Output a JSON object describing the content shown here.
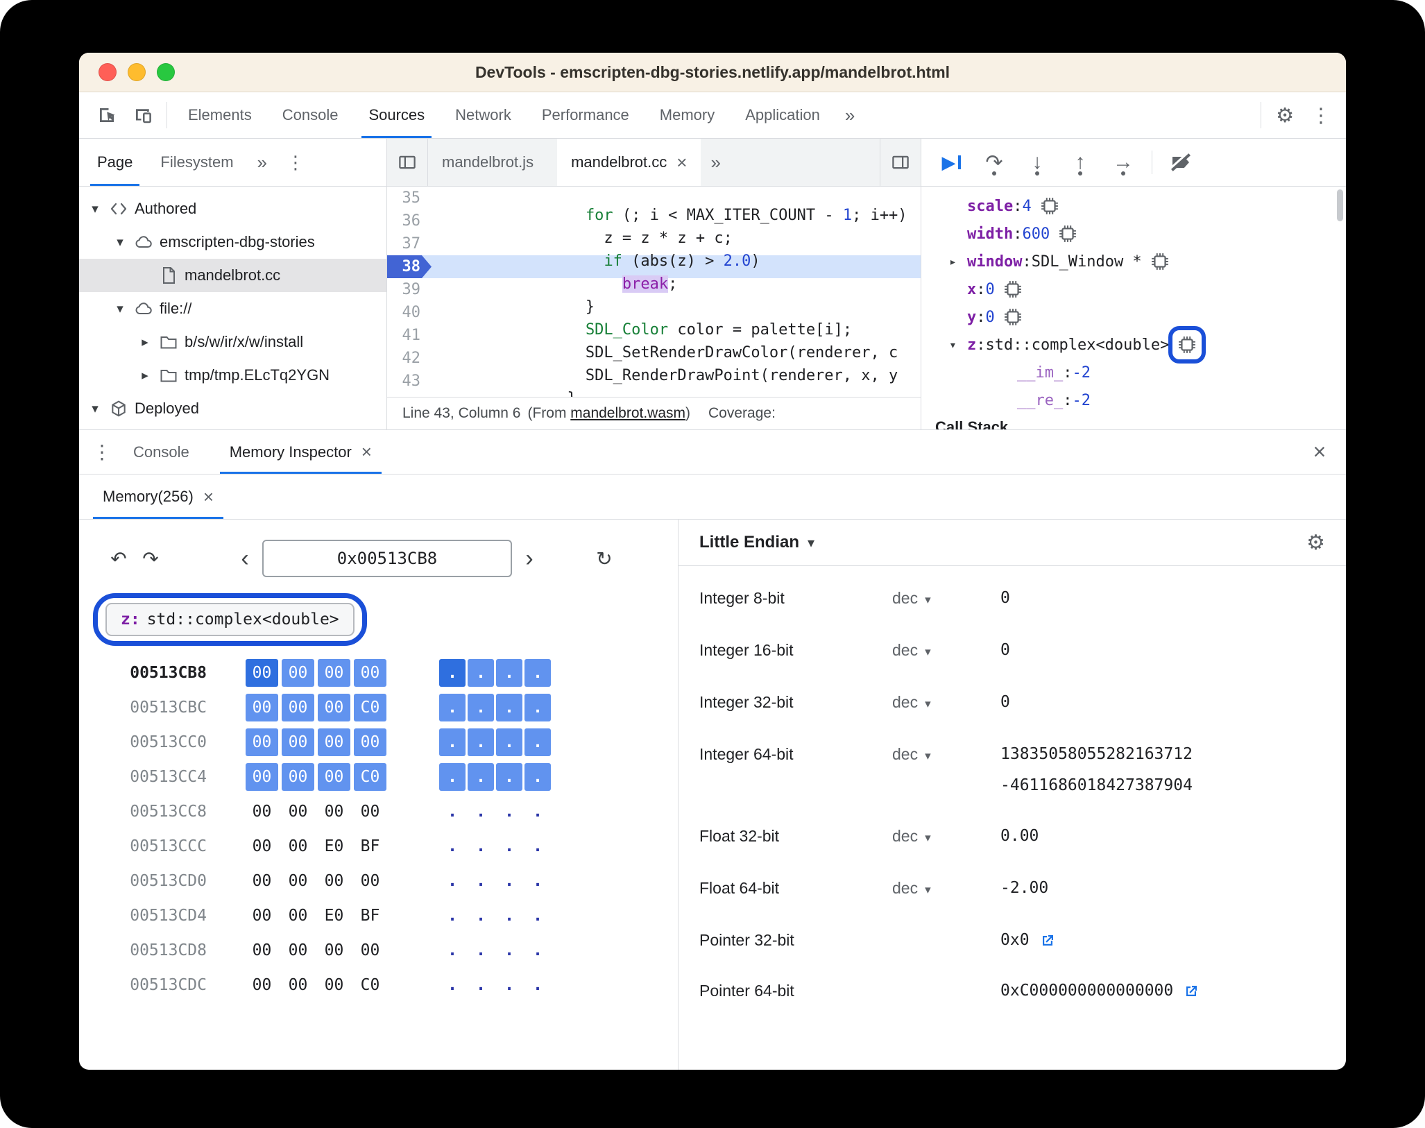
{
  "colors": {
    "accent_blue": "#1a73e8",
    "annotation_blue": "#1a4fd8",
    "memory_highlight": "#6193ef",
    "memory_focus": "#2f6fdf",
    "paused_line_bg": "#d3e3fc",
    "keyword_green": "#188038",
    "number_blue": "#2244d0",
    "variable_purple": "#7d1fa5"
  },
  "icons": {
    "gear": "⚙",
    "menu": "⋮",
    "more": "»",
    "close": "×",
    "undo": "↶",
    "redo": "↷",
    "refresh": "↻",
    "chev_left": "‹",
    "chev_right": "›",
    "dropdown": "▾",
    "resume": "▶"
  },
  "window_title": "DevTools - emscripten-dbg-stories.netlify.app/mandelbrot.html",
  "main_toolbar": {
    "tabs": [
      {
        "label": "Elements",
        "cls": ""
      },
      {
        "label": "Console",
        "cls": ""
      },
      {
        "label": "Sources",
        "cls": "active"
      },
      {
        "label": "Network",
        "cls": ""
      },
      {
        "label": "Performance",
        "cls": ""
      },
      {
        "label": "Memory",
        "cls": ""
      },
      {
        "label": "Application",
        "cls": ""
      }
    ]
  },
  "sidebar": {
    "tabs": [
      {
        "label": "Page",
        "cls": "active"
      },
      {
        "label": "Filesystem",
        "cls": ""
      }
    ],
    "tree": [
      {
        "label": "Authored",
        "icon": "ic-code",
        "chev": "▾",
        "ind": "ind-0",
        "cls": ""
      },
      {
        "label": "emscripten-dbg-stories",
        "icon": "ic-cloud",
        "chev": "▾",
        "ind": "ind-1",
        "cls": ""
      },
      {
        "label": "mandelbrot.cc",
        "icon": "ic-file",
        "chev": "",
        "ind": "ind-2",
        "cls": "selected"
      },
      {
        "label": "file://",
        "icon": "ic-cloud",
        "chev": "▾",
        "ind": "ind-1",
        "cls": ""
      },
      {
        "label": "b/s/w/ir/x/w/install",
        "icon": "ic-folder",
        "chev": "▸",
        "ind": "ind-2",
        "cls": ""
      },
      {
        "label": "tmp/tmp.ELcTq2YGN",
        "icon": "ic-folder",
        "chev": "▸",
        "ind": "ind-2",
        "cls": ""
      },
      {
        "label": "Deployed",
        "icon": "ic-cube",
        "chev": "▾",
        "ind": "ind-0",
        "cls": ""
      }
    ]
  },
  "editor": {
    "tabs": [
      {
        "label": "mandelbrot.js",
        "cls": "",
        "close": ""
      },
      {
        "label": "mandelbrot.cc",
        "cls": "active",
        "close": "×"
      }
    ],
    "lines": [
      {
        "num": "35",
        "cls": "",
        "tokens": [
          {
            "t": "    ",
            "c": ""
          },
          {
            "t": "for",
            "c": "tk-kw"
          },
          {
            "t": " (; i < MAX_ITER_COUNT - ",
            "c": ""
          },
          {
            "t": "1",
            "c": "tk-num"
          },
          {
            "t": "; i++)",
            "c": ""
          }
        ]
      },
      {
        "num": "36",
        "cls": "",
        "tokens": [
          {
            "t": "      z = z * z + c;",
            "c": ""
          }
        ]
      },
      {
        "num": "37",
        "cls": "",
        "tokens": [
          {
            "t": "      ",
            "c": ""
          },
          {
            "t": "if",
            "c": "tk-kw"
          },
          {
            "t": " (abs(z) > ",
            "c": ""
          },
          {
            "t": "2.0",
            "c": "tk-num"
          },
          {
            "t": ")",
            "c": ""
          }
        ]
      },
      {
        "num": "38",
        "cls": "paused",
        "tokens": [
          {
            "t": "        ",
            "c": ""
          },
          {
            "t": "break",
            "c": "tk-paused"
          },
          {
            "t": ";",
            "c": ""
          }
        ]
      },
      {
        "num": "39",
        "cls": "",
        "tokens": [
          {
            "t": "    }",
            "c": ""
          }
        ]
      },
      {
        "num": "40",
        "cls": "",
        "tokens": [
          {
            "t": "    ",
            "c": ""
          },
          {
            "t": "SDL_Color",
            "c": "tk-type"
          },
          {
            "t": " color = palette[i];",
            "c": ""
          }
        ]
      },
      {
        "num": "41",
        "cls": "",
        "tokens": [
          {
            "t": "    SDL_SetRenderDrawColor(renderer, c",
            "c": ""
          }
        ]
      },
      {
        "num": "42",
        "cls": "",
        "tokens": [
          {
            "t": "    SDL_RenderDrawPoint(renderer, x, y",
            "c": ""
          }
        ]
      },
      {
        "num": "43",
        "cls": "",
        "tokens": [
          {
            "t": "  }",
            "c": ""
          }
        ]
      }
    ],
    "status": {
      "position": "Line 43, Column 6",
      "from_open": "(From ",
      "link": "mandelbrot.wasm",
      "from_close": ")",
      "coverage": "Coverage:"
    }
  },
  "debugger": {
    "toolbar_icons": [
      {
        "name": "step-over-icon",
        "glyph": "↷",
        "cls": "dot-under"
      },
      {
        "name": "step-into-icon",
        "glyph": "↓",
        "cls": "dot-under"
      },
      {
        "name": "step-out-icon",
        "glyph": "↑",
        "cls": "dot-under"
      },
      {
        "name": "step-icon",
        "glyph": "→",
        "cls": "dot-under"
      }
    ],
    "scope": [
      {
        "name": "scale",
        "value": "4",
        "vcls": "v-num",
        "chev": "",
        "chip": "show",
        "rcls": ""
      },
      {
        "name": "width",
        "value": "600",
        "vcls": "v-num",
        "chev": "",
        "chip": "show",
        "rcls": ""
      },
      {
        "name": "window",
        "value": "SDL_Window *",
        "vcls": "v-obj",
        "chev": "▸",
        "chip": "show",
        "rcls": ""
      },
      {
        "name": "x",
        "value": "0",
        "vcls": "v-num",
        "chev": "",
        "chip": "show",
        "rcls": ""
      },
      {
        "name": "y",
        "value": "0",
        "vcls": "v-num",
        "chev": "",
        "chip": "show",
        "rcls": ""
      },
      {
        "name": "z",
        "value": "std::complex<double>",
        "vcls": "v-obj",
        "chev": "▾",
        "chip": "show",
        "rcls": "annotated"
      },
      {
        "name": "__im_",
        "value": "-2",
        "vcls": "v-num",
        "chev": "",
        "chip": "",
        "rcls": "child"
      },
      {
        "name": "__re_",
        "value": "-2",
        "vcls": "v-num",
        "chev": "",
        "chip": "",
        "rcls": "child"
      }
    ],
    "section_below": "Call Stack"
  },
  "drawer": {
    "tabs": [
      {
        "label": "Console",
        "cls": "",
        "close": ""
      },
      {
        "label": "Memory Inspector",
        "cls": "active",
        "close": "×"
      }
    ],
    "memory_tab": {
      "label": "Memory(256)",
      "close": "×"
    }
  },
  "memory": {
    "address_field": "0x00513CB8",
    "tag_name": "z:",
    "tag_type": "std::complex<double>",
    "rows": [
      {
        "addr": "00513CB8",
        "acls": "sel",
        "bytes": [
          {
            "v": "00",
            "c": "focus"
          },
          {
            "v": "00",
            "c": "hl"
          },
          {
            "v": "00",
            "c": "hl"
          },
          {
            "v": "00",
            "c": "hl"
          }
        ],
        "ascii": [
          {
            "v": ".",
            "c": "focus"
          },
          {
            "v": ".",
            "c": "hl"
          },
          {
            "v": ".",
            "c": "hl"
          },
          {
            "v": ".",
            "c": "hl"
          }
        ]
      },
      {
        "addr": "00513CBC",
        "acls": "",
        "bytes": [
          {
            "v": "00",
            "c": "hl"
          },
          {
            "v": "00",
            "c": "hl"
          },
          {
            "v": "00",
            "c": "hl"
          },
          {
            "v": "C0",
            "c": "hl"
          }
        ],
        "ascii": [
          {
            "v": ".",
            "c": "hl"
          },
          {
            "v": ".",
            "c": "hl"
          },
          {
            "v": ".",
            "c": "hl"
          },
          {
            "v": ".",
            "c": "hl"
          }
        ]
      },
      {
        "addr": "00513CC0",
        "acls": "",
        "bytes": [
          {
            "v": "00",
            "c": "hl"
          },
          {
            "v": "00",
            "c": "hl"
          },
          {
            "v": "00",
            "c": "hl"
          },
          {
            "v": "00",
            "c": "hl"
          }
        ],
        "ascii": [
          {
            "v": ".",
            "c": "hl"
          },
          {
            "v": ".",
            "c": "hl"
          },
          {
            "v": ".",
            "c": "hl"
          },
          {
            "v": ".",
            "c": "hl"
          }
        ]
      },
      {
        "addr": "00513CC4",
        "acls": "",
        "bytes": [
          {
            "v": "00",
            "c": "hl"
          },
          {
            "v": "00",
            "c": "hl"
          },
          {
            "v": "00",
            "c": "hl"
          },
          {
            "v": "C0",
            "c": "hl"
          }
        ],
        "ascii": [
          {
            "v": ".",
            "c": "hl"
          },
          {
            "v": ".",
            "c": "hl"
          },
          {
            "v": ".",
            "c": "hl"
          },
          {
            "v": ".",
            "c": "hl"
          }
        ]
      },
      {
        "addr": "00513CC8",
        "acls": "",
        "bytes": [
          {
            "v": "00",
            "c": ""
          },
          {
            "v": "00",
            "c": ""
          },
          {
            "v": "00",
            "c": ""
          },
          {
            "v": "00",
            "c": ""
          }
        ],
        "ascii": [
          {
            "v": ".",
            "c": ""
          },
          {
            "v": ".",
            "c": ""
          },
          {
            "v": ".",
            "c": ""
          },
          {
            "v": ".",
            "c": ""
          }
        ]
      },
      {
        "addr": "00513CCC",
        "acls": "",
        "bytes": [
          {
            "v": "00",
            "c": ""
          },
          {
            "v": "00",
            "c": ""
          },
          {
            "v": "E0",
            "c": ""
          },
          {
            "v": "BF",
            "c": ""
          }
        ],
        "ascii": [
          {
            "v": ".",
            "c": ""
          },
          {
            "v": ".",
            "c": ""
          },
          {
            "v": ".",
            "c": ""
          },
          {
            "v": ".",
            "c": ""
          }
        ]
      },
      {
        "addr": "00513CD0",
        "acls": "",
        "bytes": [
          {
            "v": "00",
            "c": ""
          },
          {
            "v": "00",
            "c": ""
          },
          {
            "v": "00",
            "c": ""
          },
          {
            "v": "00",
            "c": ""
          }
        ],
        "ascii": [
          {
            "v": ".",
            "c": ""
          },
          {
            "v": ".",
            "c": ""
          },
          {
            "v": ".",
            "c": ""
          },
          {
            "v": ".",
            "c": ""
          }
        ]
      },
      {
        "addr": "00513CD4",
        "acls": "",
        "bytes": [
          {
            "v": "00",
            "c": ""
          },
          {
            "v": "00",
            "c": ""
          },
          {
            "v": "E0",
            "c": ""
          },
          {
            "v": "BF",
            "c": ""
          }
        ],
        "ascii": [
          {
            "v": ".",
            "c": ""
          },
          {
            "v": ".",
            "c": ""
          },
          {
            "v": ".",
            "c": ""
          },
          {
            "v": ".",
            "c": ""
          }
        ]
      },
      {
        "addr": "00513CD8",
        "acls": "",
        "bytes": [
          {
            "v": "00",
            "c": ""
          },
          {
            "v": "00",
            "c": ""
          },
          {
            "v": "00",
            "c": ""
          },
          {
            "v": "00",
            "c": ""
          }
        ],
        "ascii": [
          {
            "v": ".",
            "c": ""
          },
          {
            "v": ".",
            "c": ""
          },
          {
            "v": ".",
            "c": ""
          },
          {
            "v": ".",
            "c": ""
          }
        ]
      },
      {
        "addr": "00513CDC",
        "acls": "",
        "bytes": [
          {
            "v": "00",
            "c": ""
          },
          {
            "v": "00",
            "c": ""
          },
          {
            "v": "00",
            "c": ""
          },
          {
            "v": "C0",
            "c": ""
          }
        ],
        "ascii": [
          {
            "v": ".",
            "c": ""
          },
          {
            "v": ".",
            "c": ""
          },
          {
            "v": ".",
            "c": ""
          },
          {
            "v": ".",
            "c": ""
          }
        ]
      }
    ]
  },
  "inspector": {
    "endianness": "Little Endian",
    "rows": [
      {
        "label": "Integer 8-bit",
        "mode": "dec",
        "value": "0",
        "value2": "",
        "link": ""
      },
      {
        "label": "Integer 16-bit",
        "mode": "dec",
        "value": "0",
        "value2": "",
        "link": ""
      },
      {
        "label": "Integer 32-bit",
        "mode": "dec",
        "value": "0",
        "value2": "",
        "link": ""
      },
      {
        "label": "Integer 64-bit",
        "mode": "dec",
        "value": "13835058055282163712",
        "value2": "-4611686018427387904",
        "link": ""
      },
      {
        "label": "Float 32-bit",
        "mode": "dec",
        "value": "0.00",
        "value2": "",
        "link": ""
      },
      {
        "label": "Float 64-bit",
        "mode": "dec",
        "value": "-2.00",
        "value2": "",
        "link": ""
      },
      {
        "label": "Pointer 32-bit",
        "mode": "",
        "value": "0x0",
        "value2": "",
        "link": "show"
      },
      {
        "label": "Pointer 64-bit",
        "mode": "",
        "value": "0xC000000000000000",
        "value2": "",
        "link": "show"
      }
    ]
  }
}
